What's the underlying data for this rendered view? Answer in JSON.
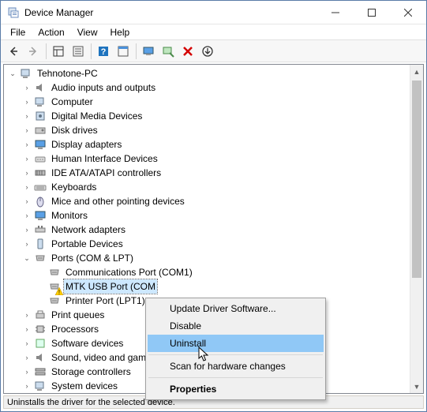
{
  "title": "Device Manager",
  "menubar": [
    "File",
    "Action",
    "View",
    "Help"
  ],
  "toolbar_icons": [
    "back",
    "forward",
    "show-hide",
    "properties",
    "help",
    "show-console",
    "monitor",
    "scan",
    "uninstall",
    "update"
  ],
  "root": "Tehnotone-PC",
  "categories": [
    "Audio inputs and outputs",
    "Computer",
    "Digital Media Devices",
    "Disk drives",
    "Display adapters",
    "Human Interface Devices",
    "IDE ATA/ATAPI controllers",
    "Keyboards",
    "Mice and other pointing devices",
    "Monitors",
    "Network adapters",
    "Portable Devices",
    "Ports (COM & LPT)"
  ],
  "ports_children": [
    {
      "label": "Communications Port (COM1)"
    },
    {
      "label": "MTK USB Port (COM",
      "warn": true,
      "selected": true
    },
    {
      "label": "Printer Port (LPT1)"
    }
  ],
  "categories_after": [
    "Print queues",
    "Processors",
    "Software devices",
    "Sound, video and game",
    "Storage controllers",
    "System devices"
  ],
  "context_menu": {
    "items": [
      {
        "label": "Update Driver Software..."
      },
      {
        "label": "Disable"
      },
      {
        "label": "Uninstall",
        "hover": true
      },
      {
        "sep": true
      },
      {
        "label": "Scan for hardware changes"
      },
      {
        "sep": true
      },
      {
        "label": "Properties",
        "bold": true
      }
    ]
  },
  "statusbar": "Uninstalls the driver for the selected device."
}
